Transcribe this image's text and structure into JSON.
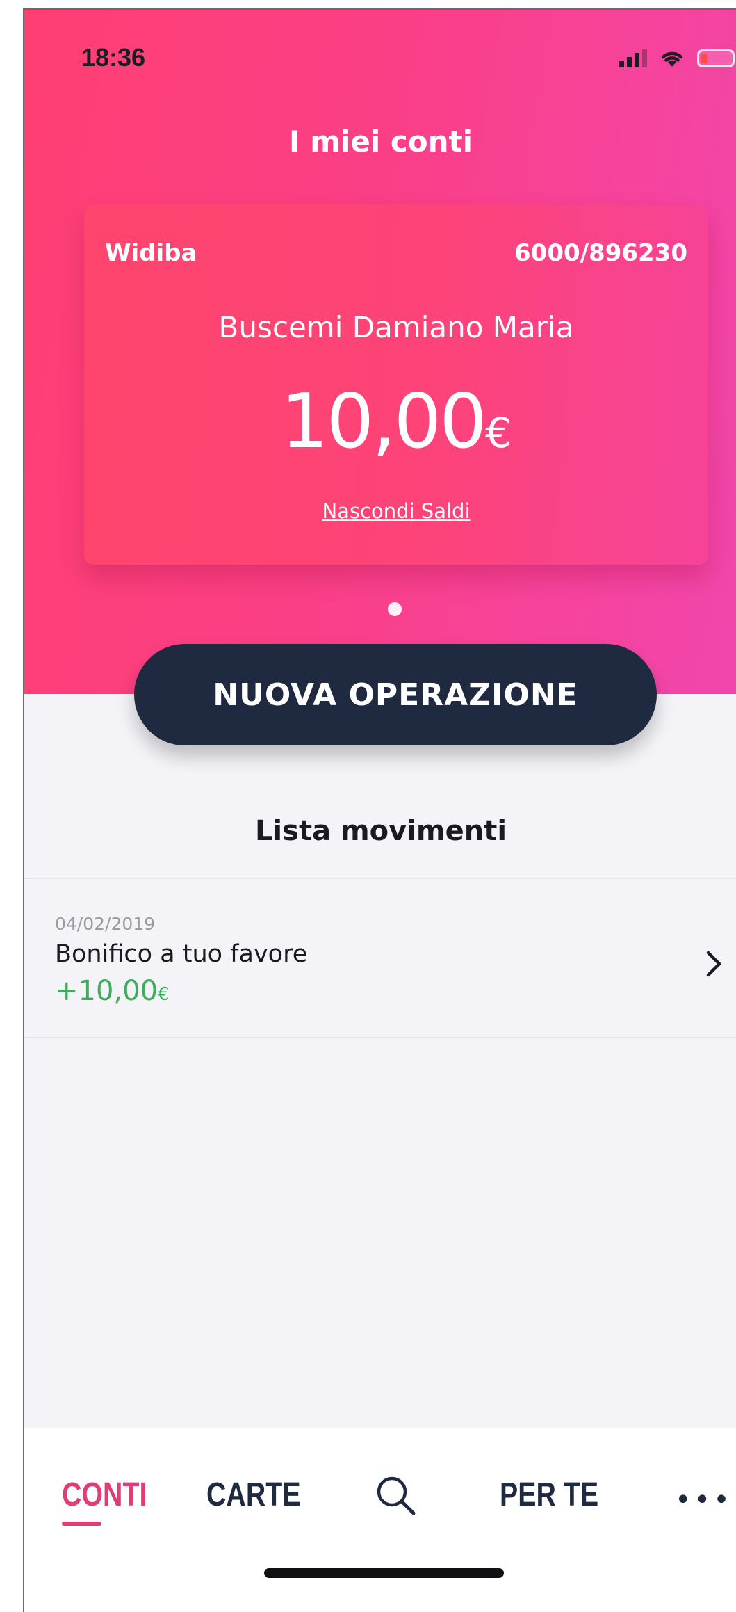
{
  "status_bar": {
    "time": "18:36"
  },
  "header": {
    "title": "I miei conti"
  },
  "account_card": {
    "bank": "Widiba",
    "account_number": "6000/896230",
    "holder": "Buscemi Damiano Maria",
    "balance": "10,00",
    "currency": "€",
    "hide_balance_link": "Nascondi Saldi"
  },
  "cta": {
    "label": "NUOVA OPERAZIONE"
  },
  "movements": {
    "title": "Lista movimenti",
    "items": [
      {
        "date": "04/02/2019",
        "description": "Bonifico a tuo favore",
        "amount": "+10,00",
        "currency": "€"
      }
    ]
  },
  "tabbar": {
    "items": [
      {
        "label": "CONTI",
        "active": true
      },
      {
        "label": "CARTE",
        "active": false
      },
      {
        "icon": "search-icon"
      },
      {
        "label": "PER TE",
        "active": false
      },
      {
        "icon": "more-icon"
      }
    ]
  },
  "colors": {
    "brand_pink": "#fb3f86",
    "dark_navy": "#1f2a40",
    "positive_green": "#3dad5c",
    "active_tab": "#e23c74"
  }
}
